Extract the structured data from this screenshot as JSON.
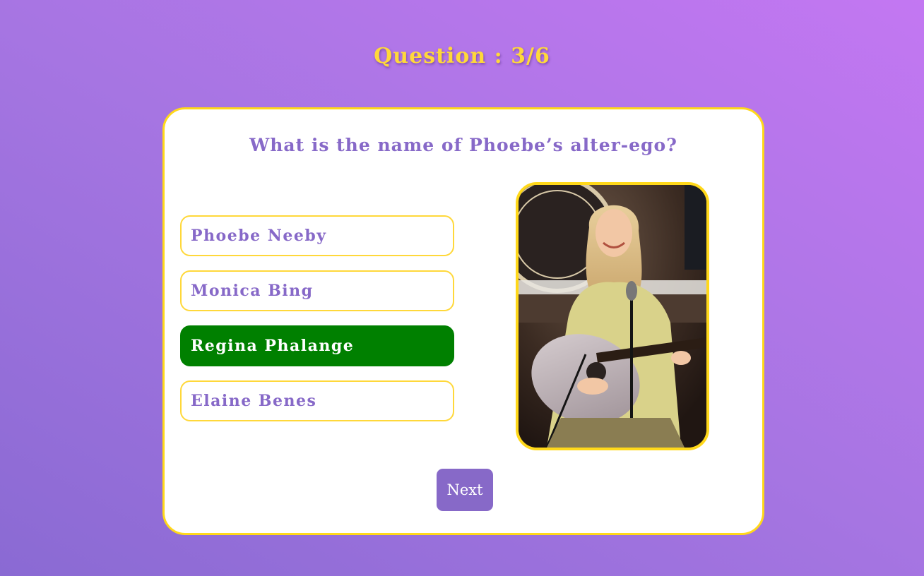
{
  "quiz": {
    "counter_label": "Question : 3/6",
    "question_text": "What is the name of Phoebe’s alter-ego?",
    "options": [
      {
        "label": "Phoebe Neeby",
        "state": "default"
      },
      {
        "label": "Monica Bing",
        "state": "default"
      },
      {
        "label": "Regina Phalange",
        "state": "correct"
      },
      {
        "label": "Elaine Benes",
        "state": "default"
      }
    ],
    "next_label": "Next"
  },
  "colors": {
    "accent_yellow": "#ffd83a",
    "primary_purple": "#8769c8",
    "correct_green": "#008000"
  }
}
